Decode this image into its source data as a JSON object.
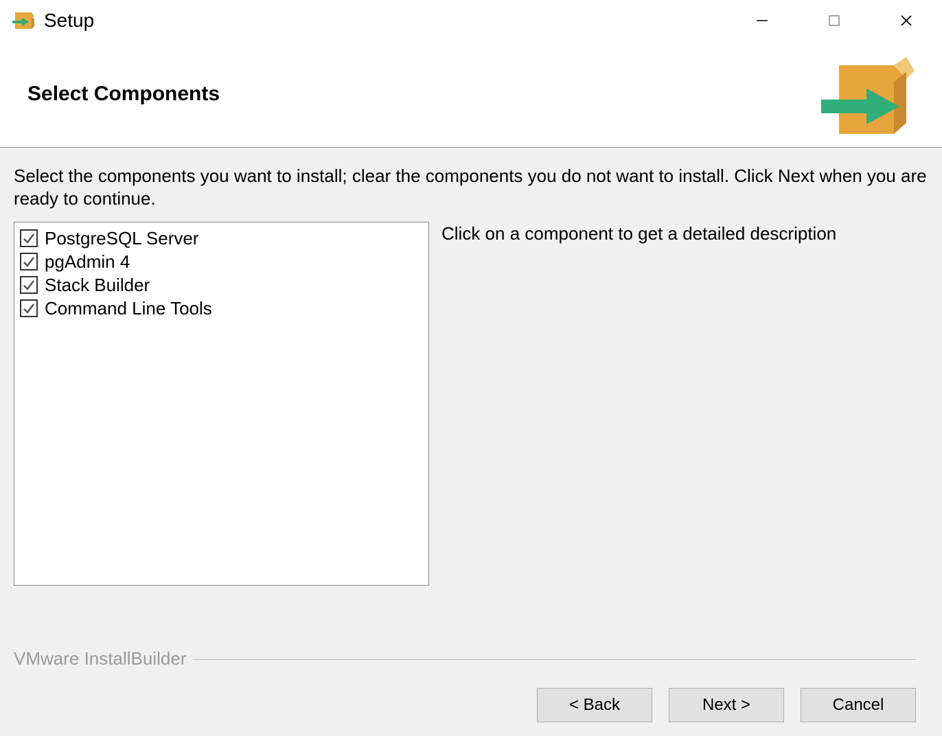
{
  "titlebar": {
    "title": "Setup"
  },
  "header": {
    "title": "Select Components"
  },
  "content": {
    "instruction": "Select the components you want to install; clear the components you do not want to install. Click Next when you are ready to continue.",
    "description_hint": "Click on a component to get a detailed description",
    "components": [
      {
        "label": "PostgreSQL Server",
        "checked": true
      },
      {
        "label": "pgAdmin 4",
        "checked": true
      },
      {
        "label": "Stack Builder",
        "checked": true
      },
      {
        "label": "Command Line Tools",
        "checked": true
      }
    ]
  },
  "footer": {
    "branding": "VMware InstallBuilder",
    "back": "< Back",
    "next": "Next >",
    "cancel": "Cancel"
  }
}
